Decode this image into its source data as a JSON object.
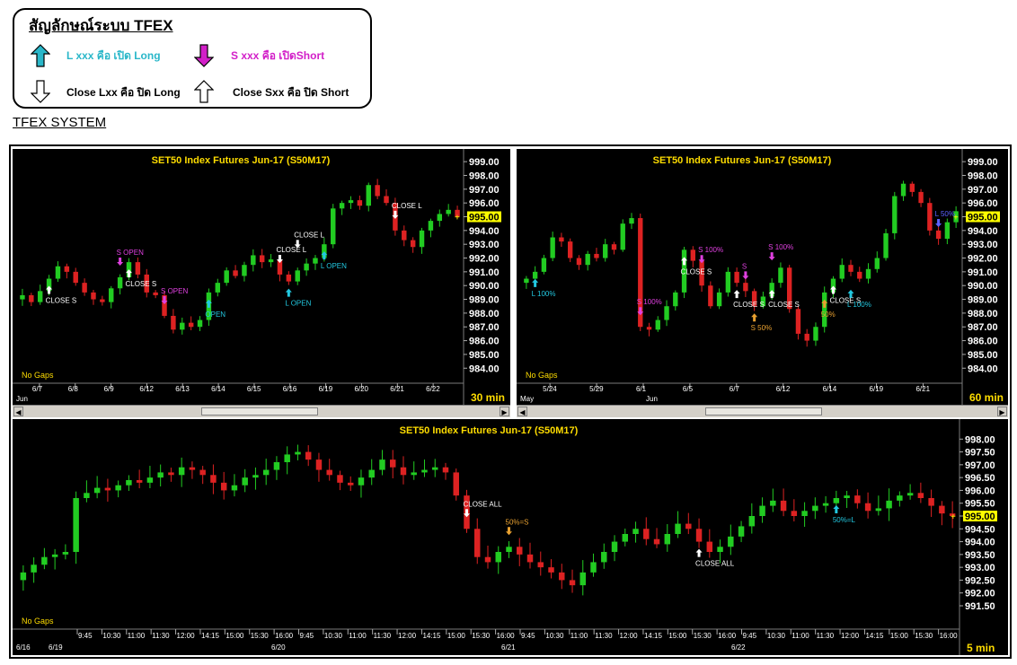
{
  "legend": {
    "title": "สัญลักษณ์ระบบ TFEX",
    "items": [
      {
        "text": "L xxx คือ เปิด Long",
        "color": "#2ab7c9"
      },
      {
        "text": "S xxx คือ เปิดShort",
        "color": "#d21fc8"
      },
      {
        "text": "Close Lxx คือ ปิด Long",
        "color": "#000000"
      },
      {
        "text": "Close Sxx คือ ปิด Short",
        "color": "#000000"
      }
    ]
  },
  "section_title": "TFEX SYSTEM",
  "colors": {
    "up": "#22cc22",
    "down": "#dd2222",
    "axis_text": "#ffffff",
    "title_text": "#ffdd00",
    "last_price_bg": "#ffff00",
    "long_signal": "#22c8e0",
    "short_signal": "#e040e0",
    "close_signal": "#ffffff",
    "half_signal": "#e8a030"
  },
  "chart_data": [
    {
      "type": "candlestick",
      "title": "SET50  Index  Futures  Jun-17   (S50M17)",
      "timeframe": "30  min",
      "no_gaps_label": "No  Gaps",
      "last_price": "995.00",
      "ylim": [
        983.3,
        999.4
      ],
      "yticks": [
        "999.00",
        "998.00",
        "997.00",
        "996.00",
        "995.00",
        "994.00",
        "993.00",
        "992.00",
        "991.00",
        "990.00",
        "989.00",
        "988.00",
        "987.00",
        "986.00",
        "985.00",
        "984.00"
      ],
      "xticks": [
        "6/7",
        "6/8",
        "6/9",
        "6/12",
        "6/13",
        "6/14",
        "6/15",
        "6/16",
        "6/19",
        "6/20",
        "6/21",
        "6/22"
      ],
      "month_label": "Jun",
      "closes": [
        989.3,
        988.8,
        989.6,
        990.5,
        991.4,
        991.0,
        990.2,
        989.5,
        989.0,
        988.8,
        989.8,
        990.6,
        991.7,
        990.8,
        989.5,
        989.3,
        987.8,
        986.8,
        987.3,
        987.0,
        987.5,
        989.5,
        990.2,
        991.1,
        990.7,
        991.5,
        992.2,
        991.7,
        991.9,
        990.8,
        990.3,
        991.1,
        991.6,
        992.0,
        993.0,
        995.6,
        996.0,
        996.2,
        995.8,
        997.3,
        996.5,
        996.0,
        994.0,
        993.3,
        992.8,
        994.0,
        994.7,
        995.2,
        995.5,
        995.0
      ],
      "annotations": [
        {
          "text": "CLOSE  S",
          "i": 3,
          "color": "#ffffff",
          "dir": "up",
          "pos": "below"
        },
        {
          "text": "S  OPEN",
          "i": 11,
          "color": "#e040e0",
          "dir": "down",
          "pos": "above"
        },
        {
          "text": "CLOSE  S",
          "i": 12,
          "color": "#ffffff",
          "dir": "up",
          "pos": "below"
        },
        {
          "text": "S  OPEN",
          "i": 16,
          "color": "#e040e0",
          "dir": "down",
          "pos": "above"
        },
        {
          "text": "OPEN",
          "i": 21,
          "color": "#22c8e0",
          "dir": "up",
          "pos": "below"
        },
        {
          "text": "CLOSE  L",
          "i": 29,
          "color": "#ffffff",
          "dir": "down",
          "pos": "above"
        },
        {
          "text": "CLOSE  L",
          "i": 31,
          "color": "#ffffff",
          "dir": "down",
          "pos": "above"
        },
        {
          "text": "L  OPEN",
          "i": 30,
          "color": "#22c8e0",
          "dir": "up",
          "pos": "below"
        },
        {
          "text": "L  OPEN",
          "i": 34,
          "color": "#22c8e0",
          "dir": "up",
          "pos": "below"
        },
        {
          "text": "CLOSE  L",
          "i": 42,
          "color": "#ffffff",
          "dir": "down",
          "pos": "above"
        }
      ]
    },
    {
      "type": "candlestick",
      "title": "SET50  Index  Futures  Jun-17   (S50M17)",
      "timeframe": "60  min",
      "no_gaps_label": "No  Gaps",
      "last_price": "995.00",
      "ylim": [
        983.3,
        999.4
      ],
      "yticks": [
        "999.00",
        "998.00",
        "997.00",
        "996.00",
        "995.00",
        "994.00",
        "993.00",
        "992.00",
        "991.00",
        "990.00",
        "989.00",
        "988.00",
        "987.00",
        "986.00",
        "985.00",
        "984.00"
      ],
      "xticks": [
        "5/24",
        "5/29",
        "6/1",
        "6/5",
        "6/7",
        "6/12",
        "6/14",
        "6/19",
        "6/21"
      ],
      "month_label": "May",
      "month_label_2": "Jun",
      "closes": [
        990.5,
        991.0,
        992.0,
        993.5,
        993.2,
        992.0,
        991.5,
        992.3,
        992.0,
        993.0,
        992.6,
        994.5,
        994.9,
        987.0,
        986.8,
        987.5,
        988.5,
        989.5,
        992.6,
        991.8,
        990.0,
        988.5,
        989.5,
        991.0,
        990.2,
        989.6,
        988.5,
        989.2,
        990.2,
        991.3,
        988.3,
        986.5,
        986.0,
        987.0,
        989.5,
        990.5,
        991.5,
        991.0,
        990.5,
        991.2,
        992.0,
        993.8,
        996.5,
        997.4,
        996.8,
        996.0,
        994.0,
        993.4,
        994.6,
        995.4
      ],
      "annotations": [
        {
          "text": "L  100%",
          "i": 1,
          "color": "#22c8e0",
          "dir": "up",
          "pos": "below"
        },
        {
          "text": "S  100%",
          "i": 13,
          "color": "#e040e0",
          "dir": "down",
          "pos": "above"
        },
        {
          "text": "CLOSE  S",
          "i": 18,
          "color": "#ffffff",
          "dir": "up",
          "pos": "below"
        },
        {
          "text": "S  100%",
          "i": 20,
          "color": "#e040e0",
          "dir": "down",
          "pos": "above"
        },
        {
          "text": "CLOSE  S",
          "i": 24,
          "color": "#ffffff",
          "dir": "up",
          "pos": "below"
        },
        {
          "text": "S  50%",
          "i": 26,
          "color": "#e8a030",
          "dir": "up",
          "pos": "below"
        },
        {
          "text": "S",
          "i": 25,
          "color": "#e040e0",
          "dir": "down",
          "pos": "above"
        },
        {
          "text": "S  100%",
          "i": 28,
          "color": "#e040e0",
          "dir": "down",
          "pos": "above"
        },
        {
          "text": "CLOSE  S",
          "i": 28,
          "color": "#ffffff",
          "dir": "up",
          "pos": "below"
        },
        {
          "text": "50%",
          "i": 34,
          "color": "#e8a030",
          "dir": "up",
          "pos": "below"
        },
        {
          "text": "CLOSE  S",
          "i": 35,
          "color": "#ffffff",
          "dir": "up",
          "pos": "below"
        },
        {
          "text": "L  100%",
          "i": 37,
          "color": "#22c8e0",
          "dir": "up",
          "pos": "below"
        },
        {
          "text": "L  50%",
          "i": 47,
          "color": "#5b62ff",
          "dir": "down",
          "pos": "above"
        }
      ]
    },
    {
      "type": "candlestick",
      "title": "SET50  Index  Futures  Jun-17   (S50M17)",
      "timeframe": "5  min",
      "no_gaps_label": "No  Gaps",
      "last_price": "995.00",
      "ylim": [
        990.8,
        998.5
      ],
      "yticks": [
        "998.00",
        "997.50",
        "997.00",
        "996.50",
        "996.00",
        "995.50",
        "995.00",
        "994.50",
        "994.00",
        "993.50",
        "993.00",
        "992.50",
        "992.00",
        "991.50"
      ],
      "xticks_time": [
        "9:45",
        "10:30",
        "11:00",
        "11:30",
        "12:00",
        "14:15",
        "15:00",
        "15:30",
        "16:00",
        "9:45",
        "10:30",
        "11:00",
        "11:30",
        "12:00",
        "14:15",
        "15:00",
        "15:30",
        "16:00",
        "9:45",
        "10:30",
        "11:00",
        "11:30",
        "12:00",
        "14:15",
        "15:00",
        "15:30",
        "16:00",
        "9:45",
        "10:30",
        "11:00",
        "11:30",
        "12:00",
        "14:15",
        "15:00",
        "15:30",
        "16:00"
      ],
      "xticks_day": [
        "6/16",
        "6/19",
        "6/20",
        "6/21",
        "6/22"
      ],
      "closes": [
        992.8,
        993.1,
        993.4,
        993.5,
        993.6,
        995.7,
        995.9,
        996.1,
        996.0,
        996.2,
        996.4,
        996.3,
        996.5,
        996.7,
        996.6,
        996.9,
        996.8,
        996.6,
        996.3,
        996.0,
        996.2,
        996.5,
        996.6,
        996.8,
        997.1,
        997.4,
        997.5,
        997.2,
        996.8,
        996.6,
        996.3,
        996.2,
        996.5,
        996.8,
        997.2,
        996.9,
        996.6,
        996.7,
        996.8,
        996.9,
        996.7,
        995.8,
        994.5,
        993.4,
        993.2,
        993.6,
        993.8,
        993.5,
        993.2,
        993.0,
        992.8,
        992.5,
        992.3,
        992.8,
        993.2,
        993.6,
        994.0,
        994.3,
        994.5,
        994.1,
        993.9,
        994.3,
        994.7,
        994.5,
        994.0,
        993.6,
        993.8,
        994.2,
        994.6,
        995.0,
        995.4,
        995.6,
        995.2,
        995.0,
        995.2,
        995.4,
        995.5,
        995.7,
        995.8,
        995.5,
        995.2,
        995.3,
        995.6,
        995.8,
        995.9,
        995.7,
        995.4,
        995.1,
        995.0
      ],
      "annotations": [
        {
          "text": "CLOSE  ALL",
          "i": 42,
          "color": "#ffffff",
          "dir": "down",
          "pos": "above"
        },
        {
          "text": "50%=S",
          "i": 46,
          "color": "#e8a030",
          "dir": "down",
          "pos": "above"
        },
        {
          "text": "CLOSE  ALL",
          "i": 64,
          "color": "#ffffff",
          "dir": "up",
          "pos": "below"
        },
        {
          "text": "50%=L",
          "i": 77,
          "color": "#22c8e0",
          "dir": "up",
          "pos": "below"
        }
      ]
    }
  ]
}
